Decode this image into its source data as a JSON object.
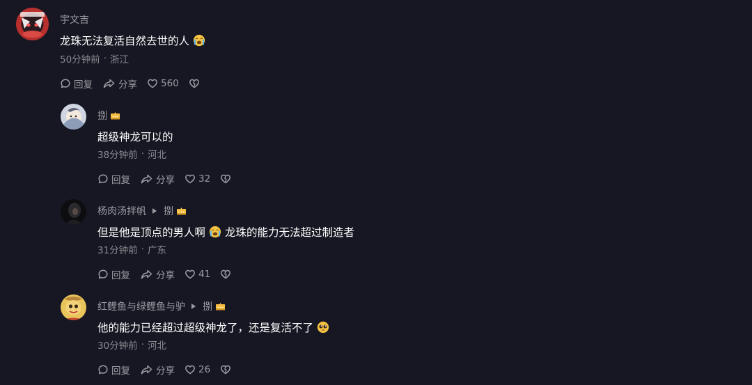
{
  "comments": [
    {
      "author": "宇文吉",
      "text_parts": [
        "龙珠无法复活自然去世的人",
        ""
      ],
      "time": "50分钟前",
      "location": "浙江",
      "reply_label": "回复",
      "share_label": "分享",
      "likes": "560"
    },
    {
      "author": "捌",
      "text_parts": [
        "超级神龙可以的"
      ],
      "time": "38分钟前",
      "location": "河北",
      "reply_label": "回复",
      "share_label": "分享",
      "likes": "32"
    },
    {
      "author": "杨肉汤拌帆",
      "reply_to": "捌",
      "text_parts": [
        "但是他是顶点的男人啊",
        "龙珠的能力无法超过制造者"
      ],
      "time": "31分钟前",
      "location": "广东",
      "reply_label": "回复",
      "share_label": "分享",
      "likes": "41"
    },
    {
      "author": "红鲤鱼与绿鲤鱼与驴",
      "reply_to": "捌",
      "text_parts": [
        "他的能力已经超过超级神龙了，还是复活不了",
        ""
      ],
      "time": "30分钟前",
      "location": "河北",
      "reply_label": "回复",
      "share_label": "分享",
      "likes": "26"
    }
  ],
  "separator": "·",
  "colors": {
    "background": "#161722",
    "secondary_text": "#9b9ca2",
    "crown": "#f5b83d"
  },
  "icons": {
    "reply": "speech-bubble-icon",
    "share": "share-arrow-icon",
    "like": "heart-outline-icon",
    "dislike": "broken-heart-icon",
    "badge": "crown-icon",
    "emoji_cry": "loudly-crying-face-emoji",
    "emoji_plead": "pleading-face-emoji"
  }
}
